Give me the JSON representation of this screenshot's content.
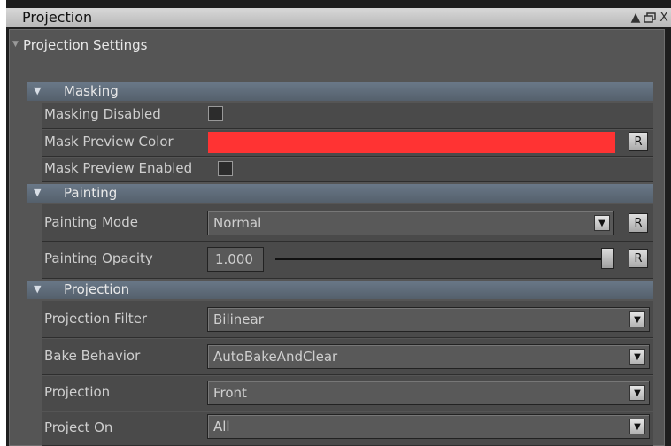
{
  "window": {
    "title": "Projection",
    "buttons": [
      {
        "name": "collapse",
        "glyph": "▲"
      },
      {
        "name": "float",
        "glyph": "🗗"
      },
      {
        "name": "close",
        "glyph": "X"
      }
    ]
  },
  "settings": {
    "label": "Projection Settings"
  },
  "sections": {
    "masking": {
      "label": "Masking",
      "masking_disabled": {
        "label": "Masking Disabled",
        "checked": false
      },
      "mask_preview_color": {
        "label": "Mask Preview Color",
        "color": "#ff3333",
        "reset": "R"
      },
      "mask_preview_enabled": {
        "label": "Mask Preview Enabled",
        "checked": false
      }
    },
    "painting": {
      "label": "Painting",
      "painting_mode": {
        "label": "Painting Mode",
        "value": "Normal",
        "reset": "R"
      },
      "painting_opacity": {
        "label": "Painting Opacity",
        "value": "1.000",
        "level": 1.0,
        "reset": "R"
      }
    },
    "projection": {
      "label": "Projection",
      "projection_filter": {
        "label": "Projection Filter",
        "value": "Bilinear"
      },
      "bake_behavior": {
        "label": "Bake Behavior",
        "value": "AutoBakeAndClear"
      },
      "projection": {
        "label": "Projection",
        "value": "Front"
      },
      "project_on": {
        "label": "Project On",
        "value": "All"
      }
    }
  },
  "icons": {
    "expand": "▼",
    "dropdown_arrow": "▼"
  }
}
